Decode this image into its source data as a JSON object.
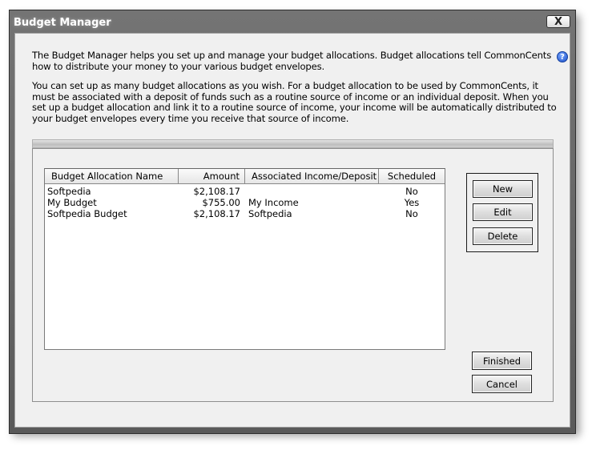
{
  "window": {
    "title": "Budget Manager",
    "close_glyph": "X"
  },
  "description": {
    "para1": "The Budget Manager helps you set up and manage your budget allocations. Budget allocations tell CommonCents how to distribute your money to your various budget envelopes.",
    "para2": "You can set up as many budget allocations as you wish. For a budget allocation to be used by CommonCents, it must be associated with a deposit of funds such as a routine source of income or an individual deposit. When you set up a budget allocation and link it to a routine source of income, your income will be automatically distributed to your budget envelopes every time you receive that source of income."
  },
  "help_icon": {
    "glyph": "?"
  },
  "table": {
    "columns": [
      "Budget Allocation Name",
      "Amount",
      "Associated Income/Deposit",
      "Scheduled"
    ],
    "rows": [
      [
        "Softpedia",
        "$2,108.17",
        "",
        "No"
      ],
      [
        "My Budget",
        "$755.00",
        "My Income",
        "Yes"
      ],
      [
        "Softpedia Budget",
        "$2,108.17",
        "Softpedia",
        "No"
      ]
    ]
  },
  "buttons": {
    "new": "New",
    "edit": "Edit",
    "delete": "Delete",
    "finished": "Finished",
    "cancel": "Cancel"
  }
}
